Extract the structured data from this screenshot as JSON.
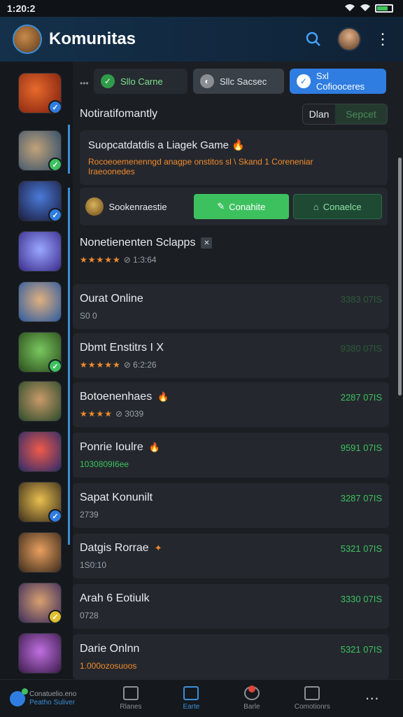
{
  "status": {
    "time": "1:20:2"
  },
  "header": {
    "title": "Komunitas"
  },
  "chips": [
    {
      "label": "Sllo Carne"
    },
    {
      "label": "Sllc Sacsec"
    },
    {
      "label": "Sxl Cofiooceres"
    }
  ],
  "section": {
    "title": "Notiratifomantly",
    "segment_a": "Dlan",
    "segment_b": "Sepcet"
  },
  "feature": {
    "title": "Suopcatdatdis a Liagek Game",
    "desc_line1": "Rocoeoemenenngd anagpe onstitos sl  \\ Skand 1 Coreneniar",
    "desc_line2": "Iraeoonedes"
  },
  "action_row": {
    "label": "Sookenraestie",
    "primary": "Conahite",
    "secondary": "Conaelce"
  },
  "first_row": {
    "name": "Nonetienenten Sclapps",
    "rating": "★★★★★",
    "meta": "⊘ 1:3:64"
  },
  "list": [
    {
      "name": "Ourat Online",
      "sub": "S0 0",
      "price": "3383 07IS"
    },
    {
      "name": "Dbmt Enstitrs I X",
      "rating": "★★★★★",
      "sub": "⊘ 6:2:26",
      "price": "9380 07IS"
    },
    {
      "name": "Botoenenhaes",
      "rating": "★★★★",
      "sub": "⊘ 3039",
      "price": "2287 07IS"
    },
    {
      "name": "Ponrie Ioulre",
      "sub": "1030809I6ee",
      "price": "9591 07IS"
    },
    {
      "name": "Sapat Konunilt",
      "sub": "2739",
      "price": "3287 07IS"
    },
    {
      "name": "Datgis Rorrae",
      "sub": "1S0:10",
      "price": "5321 07IS"
    },
    {
      "name": "Arah 6 Eotiulk",
      "sub": "0728",
      "price": "3330 07IS"
    },
    {
      "name": "Darie Onlnn",
      "sub": "1.000ozosuoos",
      "price": "5321 07IS"
    }
  ],
  "bottom_nav": {
    "first_line1": "Conatuelio.eno",
    "first_line2": "Peatho Suliver",
    "items": [
      "Rlanes",
      "Earte",
      "Barle",
      "Comotionrs"
    ]
  },
  "colors": {
    "accent": "#3b8fd8",
    "green": "#3dc15f",
    "orange": "#f08a2c"
  }
}
